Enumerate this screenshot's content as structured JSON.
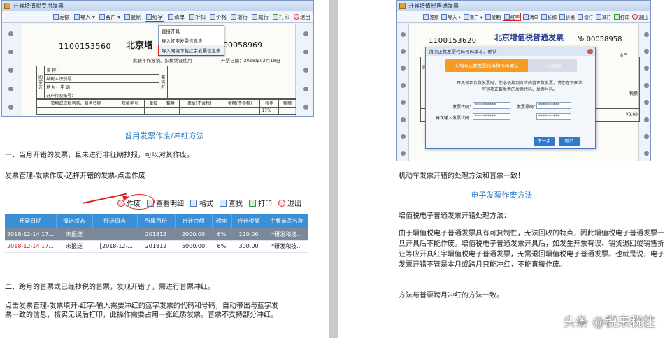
{
  "left": {
    "window": {
      "title": "开具增值税专用发票",
      "toolbar": [
        {
          "icon": "invoice-list-icon",
          "label": "差额"
        },
        {
          "icon": "import-icon",
          "label": "导入 ▾"
        },
        {
          "icon": "customer-icon",
          "label": "客户 ▾"
        },
        {
          "icon": "copy-icon",
          "label": "复制"
        },
        {
          "icon": "red-invoice-icon",
          "label": "红字"
        },
        {
          "icon": "list-icon",
          "label": "清单"
        },
        {
          "icon": "discount-icon",
          "label": "折扣"
        },
        {
          "icon": "price-icon",
          "label": "价格"
        },
        {
          "icon": "add-row-icon",
          "label": "增行"
        },
        {
          "icon": "delete-row-icon",
          "label": "减行"
        },
        {
          "icon": "print-icon",
          "label": "打印"
        },
        {
          "icon": "exit-icon",
          "label": "退出"
        }
      ],
      "dropdown": [
        "直接开具",
        "导入红字发票信息表",
        "导入网络下载红字发票信息表"
      ],
      "invoice": {
        "code": "1100153560",
        "title": "北京增",
        "no_prefix": "№",
        "number": "00058969",
        "note": "此联不作报销、扣税凭证使用",
        "date": "开票日期：2018年02月18日",
        "buyer_side": "购买方",
        "buyer_fields": [
          "名      称：",
          "纳税人识别号：",
          "地 址、电 话：",
          "开户行及账号："
        ],
        "code_side": "密码区",
        "headers": [
          "货物或应税劳务、服务名称",
          "规格型号",
          "单位",
          "数量",
          "单价(不含税)",
          "金额(不含税)",
          "税率",
          "税额"
        ],
        "tax_rate": "17%"
      }
    },
    "heading": "普用发票作废/冲红方法",
    "p1": "一、当月开错的发票，且未进行非征期抄报，可以对其作废。",
    "p2": "发票管理-发票作废-选择开错的发票-点击作废",
    "mini_toolbar": [
      {
        "icon": "void-icon",
        "label": "作废"
      },
      {
        "icon": "detail-icon",
        "label": "查看明细"
      },
      {
        "icon": "format-icon",
        "label": "格式"
      },
      {
        "icon": "find-icon",
        "label": "查找"
      },
      {
        "icon": "print-icon",
        "label": "打印"
      },
      {
        "icon": "exit-icon",
        "label": "退出"
      }
    ],
    "grid": {
      "headers": [
        "开票日期",
        "报送状态",
        "报送日志",
        "所属月份",
        "合计金额",
        "税率",
        "合计税额",
        "主要商品名称"
      ],
      "rows": [
        [
          "2018-12-14 17...",
          "未报送",
          "",
          "201812",
          "2000.00",
          "6%",
          "120.00",
          "*研发和技..."
        ],
        [
          "2018-12-14 17...",
          "未报送",
          "【2018-12-...",
          "201812",
          "5000.00",
          "6%",
          "300.00",
          "*研发和技..."
        ]
      ]
    },
    "p3": "二、跨月的普票或已经抄税的普票，发现开错了，需进行普票冲红。",
    "p4": "点击发票管理-发票填开-红字-输入需要冲红的蓝字发票的代码和号码，自动带出与蓝字发票一致的信息，核实无误后打印，此操作需要占用一张纸质发票。普票不支持部分冲红。"
  },
  "right": {
    "window": {
      "title": "开具增值税普通发票",
      "toolbar": [
        {
          "icon": "invoice-list-icon",
          "label": "差额"
        },
        {
          "icon": "import-icon",
          "label": "导入 ▾"
        },
        {
          "icon": "customer-icon",
          "label": "客户 ▾"
        },
        {
          "icon": "copy-icon",
          "label": "复制"
        },
        {
          "icon": "red-invoice-icon",
          "label": "红字"
        },
        {
          "icon": "list-icon",
          "label": "清单"
        },
        {
          "icon": "discount-icon",
          "label": "折扣"
        },
        {
          "icon": "price-icon",
          "label": "价格"
        },
        {
          "icon": "add-row-icon",
          "label": "增行"
        },
        {
          "icon": "delete-row-icon",
          "label": "减行"
        },
        {
          "icon": "print-icon",
          "label": "打印"
        },
        {
          "icon": "exit-icon",
          "label": "退出"
        }
      ],
      "invoice": {
        "code": "1100153620",
        "title": "北京增值税普通发票",
        "no_prefix": "№",
        "number": "00058958",
        "date_tail": "8日",
        "buyer_side": "购买方",
        "col_tax": "税额",
        "amount": "¥0.00"
      },
      "dialog": {
        "title": "销项正数发票代码号码填写、确认",
        "step1": "1.填写正数发票代码和号码确认",
        "step2": "2.信息",
        "text": "开具销项负数发票时，您必须找到对应的蓝正数发票，请您在下面填写销项正数发票的发票代码、发票号码。",
        "label_code": "发票代码：",
        "label_number": "发票号码：",
        "label_code_again": "再次输入发票代码：",
        "label_number_again": "再次输入发票号码：",
        "mask": "**********",
        "btn_next": "下一步",
        "btn_cancel": "取消"
      }
    },
    "p1": "机动车发票开错的处理方法和普票一致！",
    "heading": "电子发票作废方法",
    "p2": "增值税电子普通发票开错处理方法：",
    "p3": "由于增值税电子普通发票具有可复制性，无法回收的特点，因此增值税电子普通发票一旦开具后不能作废。增值税电子普通发票开具后，如发生开票有误、销货退回或销售折让等应开具红字增值税电子普通发票，无需退回增值税电子普通发票。也就是说，电子发票开错不管是本月或跨月只能冲红，不能直接作废。",
    "p4": "方法与普票跨月冲红的方法一致。"
  },
  "watermark": "头条 @税来税往"
}
